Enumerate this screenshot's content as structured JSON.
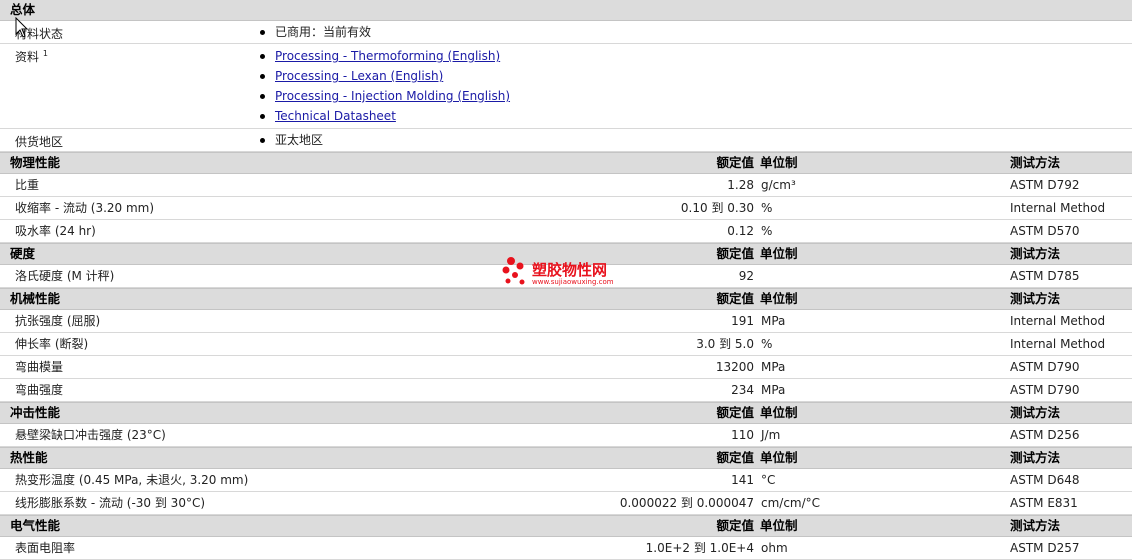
{
  "general": {
    "title": "总体",
    "status_label": "材料状态",
    "status_value": "已商用：当前有效",
    "docs_label": "资料",
    "docs_sup": "1",
    "docs": [
      "Processing - Thermoforming (English)",
      "Processing - Lexan (English)",
      "Processing - Injection Molding (English)",
      "Technical Datasheet"
    ],
    "region_label": "供货地区",
    "region_value": "亚太地区"
  },
  "header_labels": {
    "value": "额定值",
    "unit": "单位制",
    "method": "测试方法"
  },
  "sections": [
    {
      "title": "物理性能",
      "rows": [
        {
          "label": "比重",
          "value": "1.28",
          "unit": "g/cm³",
          "method": "ASTM D792"
        },
        {
          "label": "收缩率 - 流动 (3.20 mm)",
          "value": "0.10 到 0.30",
          "unit": "%",
          "method": "Internal Method"
        },
        {
          "label": "吸水率 (24 hr)",
          "value": "0.12",
          "unit": "%",
          "method": "ASTM D570"
        }
      ]
    },
    {
      "title": "硬度",
      "rows": [
        {
          "label": "洛氏硬度 (M 计秤)",
          "value": "92",
          "unit": "",
          "method": "ASTM D785"
        }
      ]
    },
    {
      "title": "机械性能",
      "rows": [
        {
          "label": "抗张强度 (屈服)",
          "value": "191",
          "unit": "MPa",
          "method": "Internal Method"
        },
        {
          "label": "伸长率 (断裂)",
          "value": "3.0 到 5.0",
          "unit": "%",
          "method": "Internal Method"
        },
        {
          "label": "弯曲模量",
          "value": "13200",
          "unit": "MPa",
          "method": "ASTM D790"
        },
        {
          "label": "弯曲强度",
          "value": "234",
          "unit": "MPa",
          "method": "ASTM D790"
        }
      ]
    },
    {
      "title": "冲击性能",
      "rows": [
        {
          "label": "悬壁梁缺口冲击强度 (23°C)",
          "value": "110",
          "unit": "J/m",
          "method": "ASTM D256"
        }
      ]
    },
    {
      "title": "热性能",
      "rows": [
        {
          "label": "热变形温度 (0.45 MPa, 未退火, 3.20 mm)",
          "value": "141",
          "unit": "°C",
          "method": "ASTM D648"
        },
        {
          "label": "线形膨胀系数 - 流动 (-30 到 30°C)",
          "value": "0.000022 到 0.000047",
          "unit": "cm/cm/°C",
          "method": "ASTM E831"
        }
      ]
    },
    {
      "title": "电气性能",
      "rows": [
        {
          "label": "表面电阻率",
          "value": "1.0E+2 到 1.0E+4",
          "unit": "ohm",
          "method": "ASTM D257"
        }
      ]
    }
  ],
  "watermark": {
    "text": "塑胶物性网",
    "url": "www.sujiaowuxing.com",
    "color": "#e8121d"
  }
}
